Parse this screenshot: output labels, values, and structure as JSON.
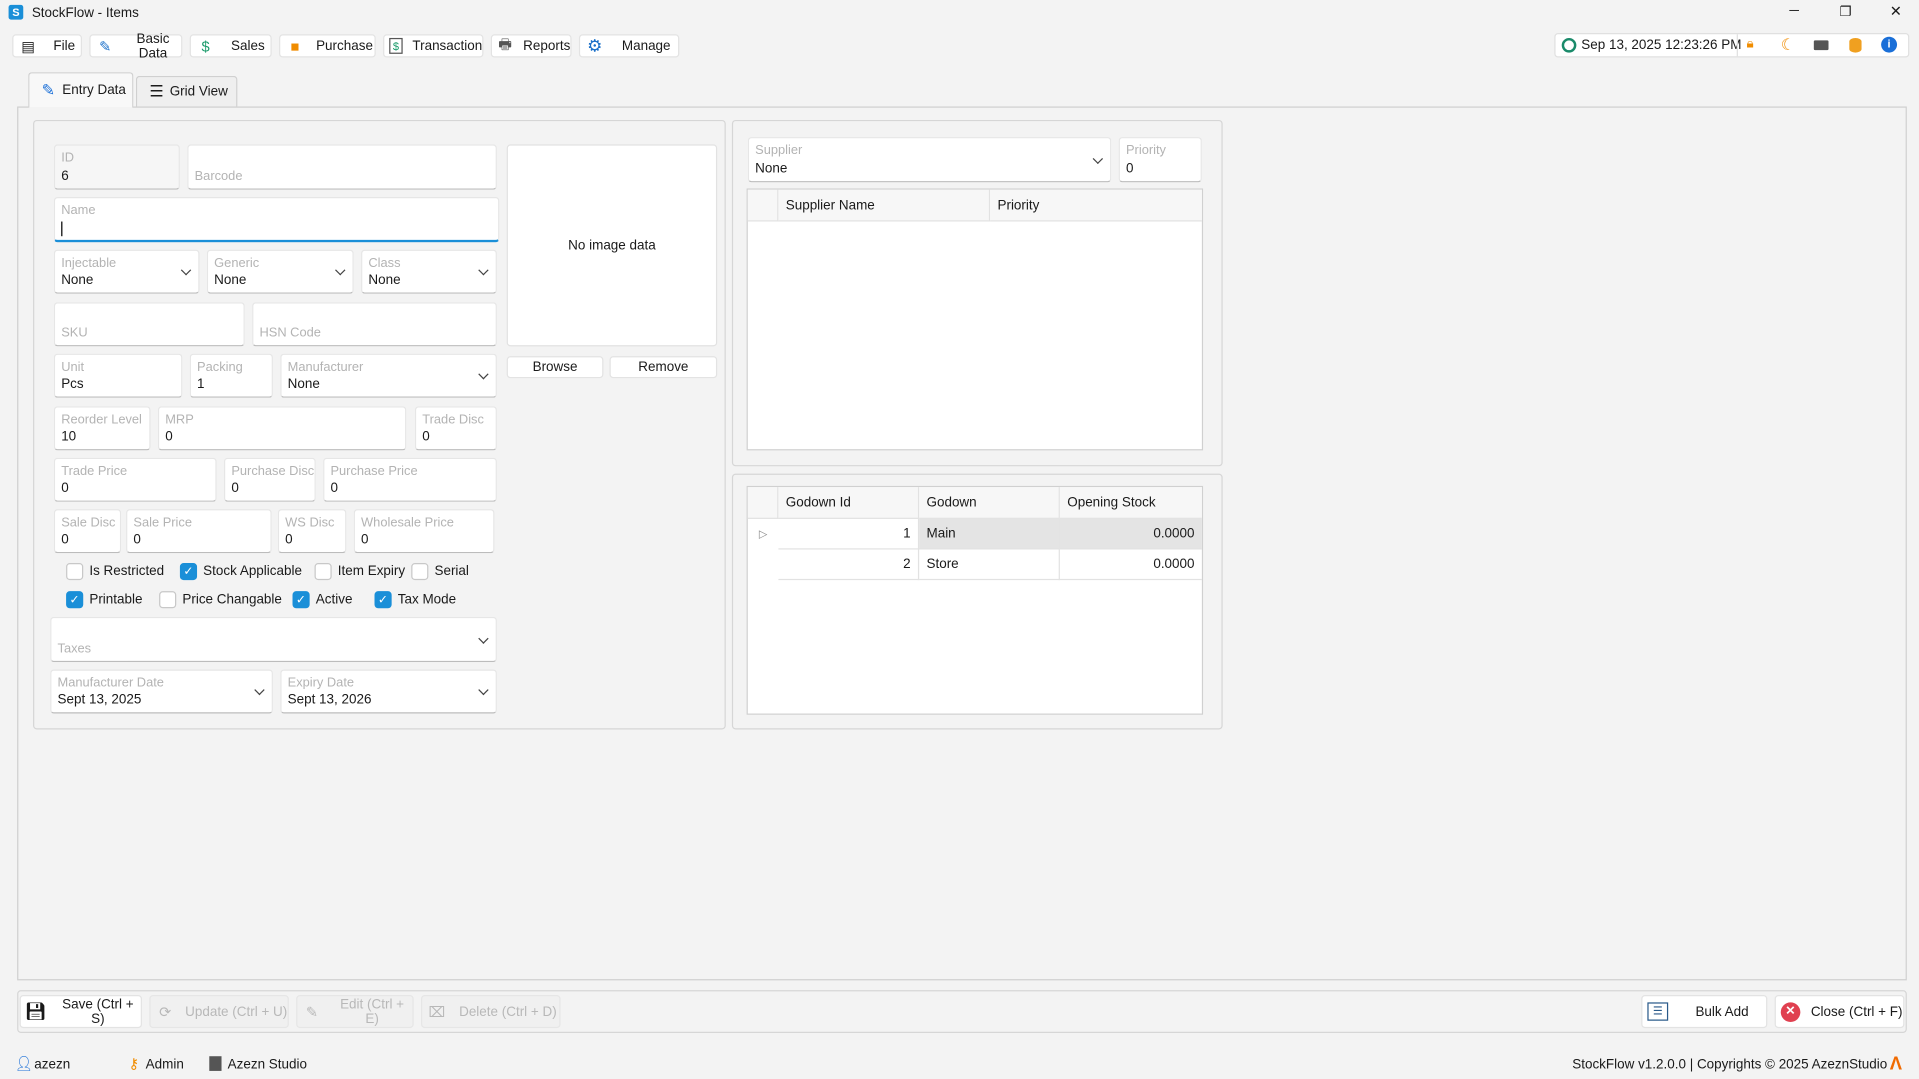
{
  "window": {
    "title": "StockFlow - Items",
    "app_icon": "S",
    "minimize": "─",
    "restore": "❐",
    "close": "✕"
  },
  "menu": [
    {
      "label": "File",
      "icon": "file-icon"
    },
    {
      "label": "Basic Data",
      "icon": "basic-data-icon"
    },
    {
      "label": "Sales",
      "icon": "sales-icon"
    },
    {
      "label": "Purchase",
      "icon": "purchase-cart-icon"
    },
    {
      "label": "Transaction",
      "icon": "dollar-icon"
    },
    {
      "label": "Reports",
      "icon": "printer-icon"
    },
    {
      "label": "Manage",
      "icon": "gear-icon"
    }
  ],
  "toolbar": {
    "datetime": "Sep 13, 2025 12:23:26 PM",
    "icons": [
      "lock-icon",
      "moon-icon",
      "keyboard-icon",
      "database-icon",
      "info-icon"
    ]
  },
  "tabs": [
    {
      "label": "Entry Data",
      "active": true
    },
    {
      "label": "Grid View",
      "active": false
    }
  ],
  "form": {
    "id": {
      "label": "ID",
      "value": "6"
    },
    "barcode": {
      "label": "Barcode",
      "value": ""
    },
    "name": {
      "label": "Name",
      "value": ""
    },
    "injectable": {
      "label": "Injectable",
      "value": "None"
    },
    "generic": {
      "label": "Generic",
      "value": "None"
    },
    "class": {
      "label": "Class",
      "value": "None"
    },
    "sku": {
      "label": "SKU",
      "value": ""
    },
    "hsn": {
      "label": "HSN Code",
      "value": ""
    },
    "unit": {
      "label": "Unit",
      "value": "Pcs"
    },
    "packing": {
      "label": "Packing",
      "value": "1"
    },
    "manufacturer": {
      "label": "Manufacturer",
      "value": "None"
    },
    "reorder_level": {
      "label": "Reorder Level",
      "value": "10"
    },
    "mrp": {
      "label": "MRP",
      "value": "0"
    },
    "trade_disc": {
      "label": "Trade Disc",
      "value": "0"
    },
    "trade_price": {
      "label": "Trade Price",
      "value": "0"
    },
    "purchase_disc": {
      "label": "Purchase Disc",
      "value": "0"
    },
    "purchase_price": {
      "label": "Purchase Price",
      "value": "0"
    },
    "sale_disc": {
      "label": "Sale Disc",
      "value": "0"
    },
    "sale_price": {
      "label": "Sale Price",
      "value": "0"
    },
    "ws_disc": {
      "label": "WS Disc",
      "value": "0"
    },
    "wholesale_price": {
      "label": "Wholesale Price",
      "value": "0"
    },
    "taxes": {
      "label": "Taxes",
      "value": ""
    },
    "mfg_date": {
      "label": "Manufacturer Date",
      "value": "Sept 13, 2025"
    },
    "expiry_date": {
      "label": "Expiry Date",
      "value": "Sept 13, 2026"
    },
    "checkboxes": [
      {
        "label": "Is Restricted",
        "checked": false
      },
      {
        "label": "Stock Applicable",
        "checked": true
      },
      {
        "label": "Item Expiry",
        "checked": false
      },
      {
        "label": "Serial",
        "checked": false
      },
      {
        "label": "Printable",
        "checked": true
      },
      {
        "label": "Price Changable",
        "checked": false
      },
      {
        "label": "Active",
        "checked": true
      },
      {
        "label": "Tax Mode",
        "checked": true
      }
    ]
  },
  "image": {
    "placeholder": "No image data",
    "browse": "Browse",
    "remove": "Remove"
  },
  "supplier": {
    "label": "Supplier",
    "value": "None",
    "priority_label": "Priority",
    "priority_value": "0",
    "columns": [
      "Supplier Name",
      "Priority"
    ],
    "rows": []
  },
  "godown": {
    "columns": [
      "Godown Id",
      "Godown",
      "Opening Stock"
    ],
    "rows": [
      {
        "id": "1",
        "name": "Main",
        "stock": "0.0000"
      },
      {
        "id": "2",
        "name": "Store",
        "stock": "0.0000"
      }
    ]
  },
  "actions": {
    "save": "Save (Ctrl + S)",
    "update": "Update (Ctrl + U)",
    "edit": "Edit (Ctrl + E)",
    "delete": "Delete (Ctrl + D)",
    "bulk_add": "Bulk Add",
    "close": "Close (Ctrl + F)"
  },
  "status": {
    "user": "azezn",
    "role": "Admin",
    "company": "Azezn Studio",
    "copyright": "StockFlow v1.2.0.0 | Copyrights © 2025 AzeznStudio"
  },
  "colors": {
    "accent": "#1a8fd8",
    "orange": "#f08c00",
    "close_red": "#e04050"
  }
}
